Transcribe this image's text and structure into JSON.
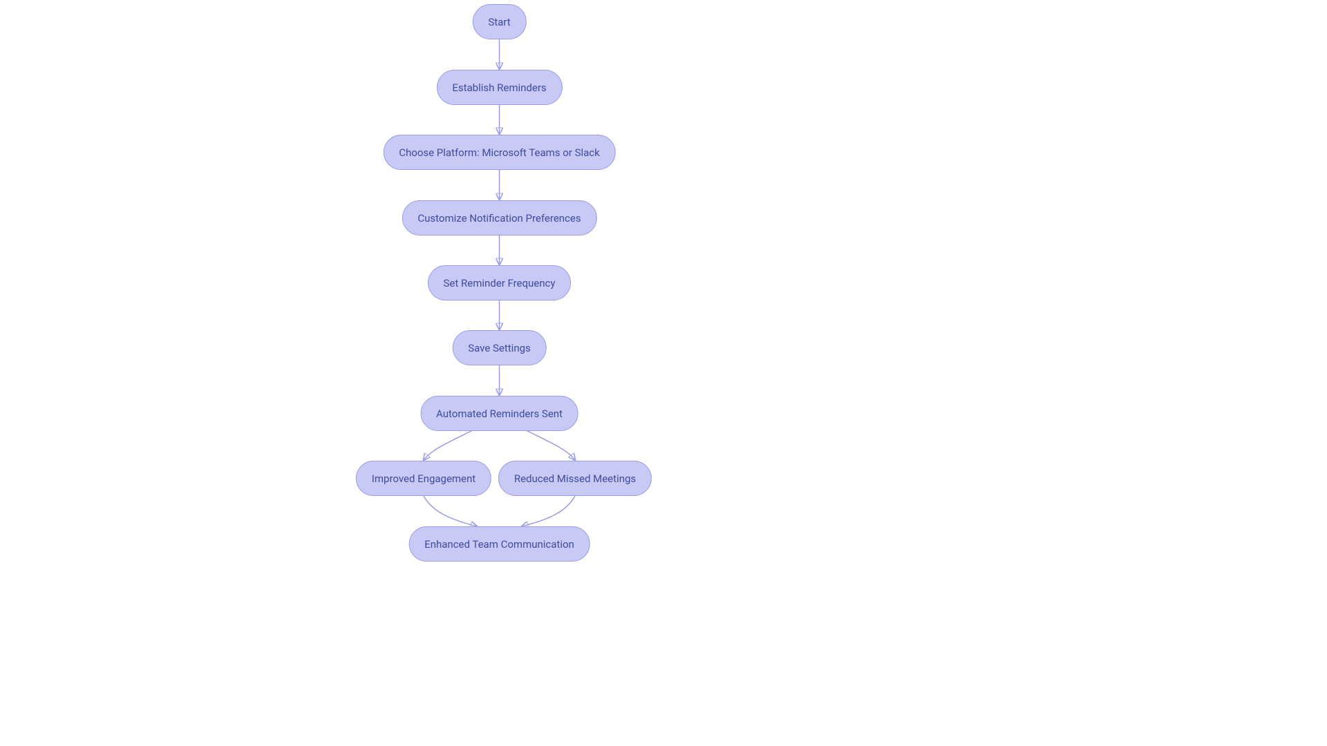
{
  "nodes": {
    "start": {
      "label": "Start"
    },
    "establish": {
      "label": "Establish Reminders"
    },
    "choose": {
      "label": "Choose Platform: Microsoft Teams or Slack"
    },
    "customize": {
      "label": "Customize Notification Preferences"
    },
    "frequency": {
      "label": "Set Reminder Frequency"
    },
    "save": {
      "label": "Save Settings"
    },
    "sent": {
      "label": "Automated Reminders Sent"
    },
    "engagement": {
      "label": "Improved Engagement"
    },
    "missed": {
      "label": "Reduced Missed Meetings"
    },
    "enhanced": {
      "label": "Enhanced Team Communication"
    }
  },
  "colors": {
    "node_fill": "#c8c9f5",
    "node_stroke": "#9a9ae8",
    "node_text": "#3e4a9e",
    "edge": "#9a9ae8"
  }
}
